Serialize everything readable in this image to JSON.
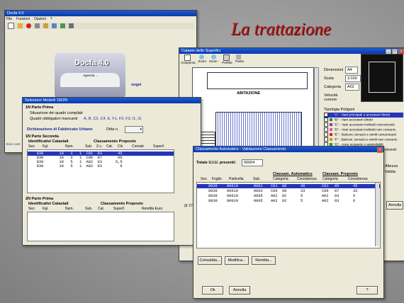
{
  "slide": {
    "title": "La trattazione"
  },
  "main_window": {
    "title": "Docfa 4.0",
    "menu": [
      "File",
      "Funzioni",
      "Opzioni",
      "?"
    ],
    "logo_text": "Docfa 4.0",
    "small_left": "Euro cont",
    "sogei": "sogei",
    "agenzia": "Agenzia ..."
  },
  "selezione": {
    "title": "Selezione Modelli 1N/2N",
    "section_1n": "1N Parte Prima",
    "situazione_label": "Situazione dei quadri compilati",
    "quadri_label": "Quadri obbligatori mancanti",
    "quadri_value": "A, B, C2, C4, E, F1, F2, F3, I1, I2,",
    "dich_label": "Dichiarazione di Fabbricato Urbano",
    "ditta_label": "Ditta n.",
    "section_2": "1N Parte Seconda",
    "ident_header": "Identificativi Catastali",
    "class_header": "Classamento Proposto",
    "cols_top": [
      "Sez.",
      "Fgl.",
      "Num.",
      "Sub.",
      "Z.c.",
      "Cat.",
      "Cls",
      "Consist.",
      "Superf."
    ],
    "rows_top": [
      "    830       10   1   1  C01  03       45",
      "    830       10   3   1  C06  07       60",
      "    830       10   5   1  A02  03      5,5",
      "    830       10   5   1  A02  03        6"
    ],
    "section_2n": "2N Parte Prima",
    "cols_bottom": [
      "Sez.",
      "Fgl.",
      "Num.",
      "Sub.",
      "Cat.",
      "Superf.",
      "Rendita Euro"
    ],
    "side_value": "(E 279)"
  },
  "catasto": {
    "title": "Catasto delle Superfici",
    "toolbar": [
      "Anteprima",
      "Zoom",
      "Zoom -",
      "Perfetti",
      "Trasla"
    ],
    "dimensioni_label": "Dimensioni",
    "dimensioni_value": "A4",
    "scala_label": "Scala",
    "scala_value": "1/100",
    "categoria_label": "Categoria",
    "categoria_value": "A02",
    "velocita_label": "Velocità cursore",
    "tipologia_label": "Tipologia Poligoni",
    "legend": [
      {
        "code": "A",
        "label": "\"A\" - Vani principali e accessori diretti",
        "color": "#2a3aa8"
      },
      {
        "code": "B",
        "label": "\"B\" - Vani accessori diretti",
        "color": "#1a8a3a"
      },
      {
        "code": "C",
        "label": "\"C\" - Vani accessori indiretti comunicanti",
        "color": "#b02a9a"
      },
      {
        "code": "D",
        "label": "\"D\" - Vani accessori indiretti non comunic.",
        "color": "#d05aa0"
      },
      {
        "code": "E",
        "label": "\"E\" - Balconi, terrazzi e simili comunicanti",
        "color": "#d82020"
      },
      {
        "code": "F",
        "label": "\"F\" - Balconi, terrazzi e simili non comunic.",
        "color": "#e08a10"
      },
      {
        "code": "G",
        "label": "\"G\" - Aree scoperte o assimilabili",
        "color": "#209a20"
      },
      {
        "code": "H",
        "label": "\"H\" - Superfici non rilevanti ai fini catastali",
        "color": "#20a0c0"
      }
    ],
    "doc_heading": "ABITAZIONE",
    "right_panel_labels": [
      "Altezza",
      "Valida"
    ],
    "annulla": "Annulla"
  },
  "validazione": {
    "title": "Classamento Automatico - Validazione Classamento",
    "totale_label": "Totale U.I.U. presenti:",
    "totale_value": "00004",
    "group_auto": "Classam. Automatico",
    "group_prop": "Classam. Proposto",
    "cols": [
      "Sez.",
      "Foglio",
      "Particella",
      "Sub.",
      "Categoria",
      "Consistenza",
      "Categoria",
      "Consistenza"
    ],
    "rows": [
      [
        "",
        "0830",
        "00010",
        "0001",
        "C01",
        "08",
        "36",
        "C01",
        "05",
        "45"
      ],
      [
        "",
        "0830",
        "00010",
        "0003",
        "C06",
        "08",
        "33",
        "C06",
        "07",
        "33"
      ],
      [
        "",
        "0830",
        "00010",
        "0005",
        "A02",
        "02",
        "5",
        "A02",
        "03",
        "5"
      ],
      [
        "",
        "0830",
        "00010",
        "0005",
        "A02",
        "02",
        "5",
        "A02",
        "03",
        "6"
      ]
    ],
    "buttons": {
      "convalida": "Convalida...",
      "modifica": "Modifica...",
      "rendita": "Rendita...",
      "ok": "Ok",
      "annulla": "Annulla",
      "help": "?"
    }
  }
}
